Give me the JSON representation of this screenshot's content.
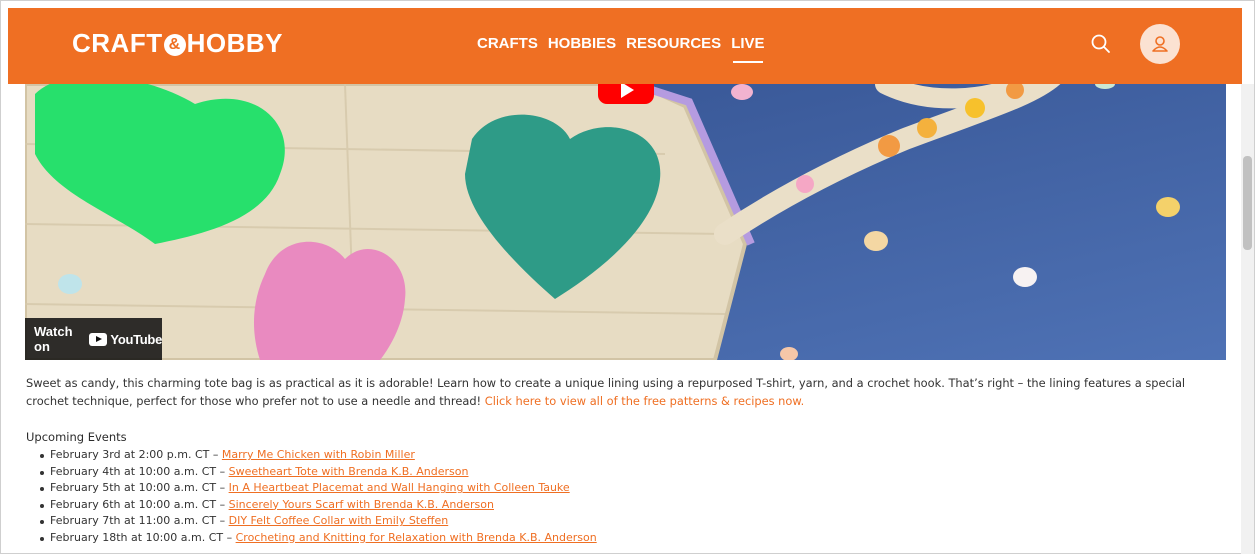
{
  "header": {
    "logo_left": "CRAFT",
    "logo_amp": "&",
    "logo_right": "HOBBY",
    "nav": [
      "CRAFTS",
      "HOBBIES",
      "RESOURCES",
      "LIVE"
    ],
    "active_nav": "LIVE",
    "brand_color": "#ef6f23"
  },
  "video": {
    "watch_on": "Watch on",
    "youtube_label": "YouTube"
  },
  "description": {
    "text": "Sweet as candy, this charming tote bag is as practical as it is adorable! Learn how to create a unique lining using a repurposed T-shirt, yarn, and a crochet hook. That’s right – the lining features a special crochet technique, perfect for those who prefer not to use a needle and thread! ",
    "link": "Click here to view all of the free patterns & recipes now."
  },
  "events": {
    "heading": "Upcoming Events",
    "items": [
      {
        "date": "February 3rd at 2:00 p.m. CT – ",
        "title": "Marry Me Chicken with Robin Miller"
      },
      {
        "date": "February 4th at 10:00 a.m. CT – ",
        "title": "Sweetheart Tote with Brenda K.B. Anderson"
      },
      {
        "date": "February 5th at 10:00 a.m. CT – ",
        "title": "In A Heartbeat Placemat and Wall Hanging with Colleen Tauke"
      },
      {
        "date": "February 6th at 10:00 a.m. CT – ",
        "title": "Sincerely Yours Scarf with Brenda K.B. Anderson"
      },
      {
        "date": "February 7th at 11:00 a.m. CT – ",
        "title": "DIY Felt Coffee Collar with Emily Steffen"
      },
      {
        "date": "February 18th at 10:00 a.m. CT – ",
        "title": "Crocheting and Knitting for Relaxation with Brenda K.B. Anderson"
      }
    ]
  },
  "icons": [
    "search-icon",
    "user-icon",
    "play-icon",
    "youtube-icon"
  ]
}
